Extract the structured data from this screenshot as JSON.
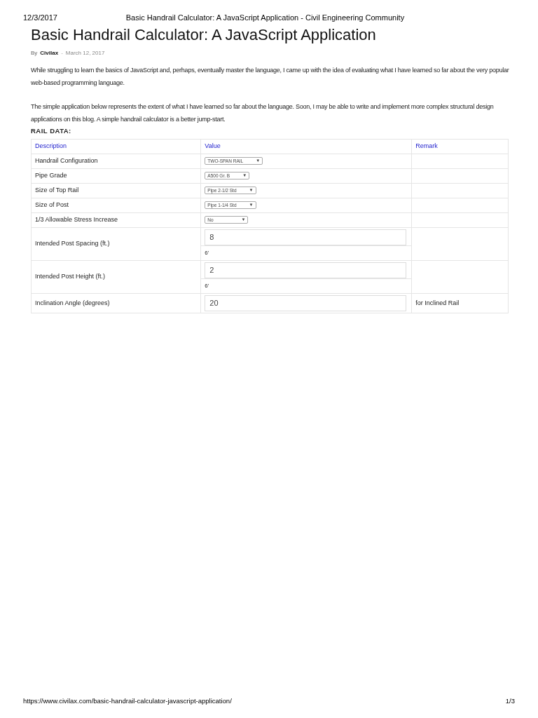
{
  "print_header": {
    "date": "12/3/2017",
    "title": "Basic Handrail Calculator: A JavaScript Application - Civil Engineering Community"
  },
  "article": {
    "title": "Basic Handrail Calculator: A JavaScript Application",
    "byline": {
      "prefix": "By",
      "author": "Civilax",
      "separator": "-",
      "date": "March 12, 2017"
    },
    "paragraphs": [
      "While struggling to learn the basics of JavaScript and, perhaps, eventually master the language, I came up with the idea of evaluating what I have learned so far about the very popular web-based programming language.",
      "The simple application below represents the extent of what I have learned so far about the language. Soon, I may be able to write and implement more complex structural design applications on this blog. A simple handrail calculator is a better jump-start."
    ],
    "section_label": "RAIL DATA:"
  },
  "table": {
    "columns": [
      "Description",
      "Value",
      "Remark"
    ],
    "rows": [
      {
        "label": "Handrail Configuration",
        "kind": "select",
        "value": "TWO-SPAN RAIL",
        "caret": "▼"
      },
      {
        "label": "Pipe Grade",
        "kind": "select",
        "value": "A500 Gr. B",
        "caret": "▼"
      },
      {
        "label": "Size of Top Rail",
        "kind": "select",
        "value": "Pipe 2-1/2 Std",
        "caret": "▼"
      },
      {
        "label": "Size of Post",
        "kind": "select",
        "value": "Pipe 1-1/4 Std",
        "caret": "▼"
      },
      {
        "label": "1/3 Allowable Stress Increase",
        "kind": "select",
        "value": "No",
        "caret": "▼"
      },
      {
        "label": "Intended Post Spacing (ft.)",
        "kind": "input",
        "value": "8",
        "note": "6'"
      },
      {
        "label": "Intended Post Height (ft.)",
        "kind": "input",
        "value": "2",
        "note": "6'"
      },
      {
        "label": "Inclination Angle (degrees)",
        "kind": "input",
        "value": "20",
        "remark": "for Inclined Rail"
      }
    ]
  },
  "print_footer": {
    "url": "https://www.civilax.com/basic-handrail-calculator-javascript-application/",
    "page": "1/3"
  }
}
